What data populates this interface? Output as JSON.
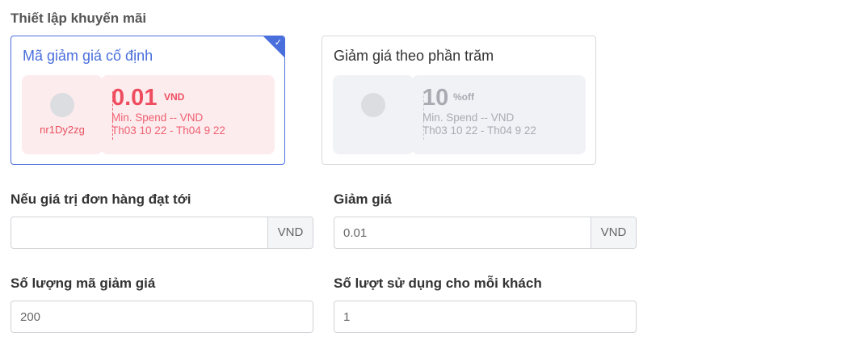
{
  "section_title": "Thiết lập khuyến mãi",
  "promo_types": {
    "fixed": {
      "title": "Mã giảm giá cố định",
      "code": "nr1Dy2zg",
      "amount": "0.01",
      "unit": "VND",
      "min_spend": "Min. Spend -- VND",
      "date_range": "Th03 10 22 - Th04 9 22",
      "selected": true
    },
    "percent": {
      "title": "Giảm giá theo phần trăm",
      "amount": "10",
      "unit": "%off",
      "min_spend": "Min. Spend -- VND",
      "date_range": "Th03 10 22 - Th04 9 22",
      "selected": false
    }
  },
  "fields": {
    "min_order": {
      "label": "Nếu giá trị đơn hàng đạt tới",
      "value": "",
      "addon": "VND"
    },
    "discount": {
      "label": "Giảm giá",
      "value": "0.01",
      "addon": "VND"
    },
    "quantity": {
      "label": "Số lượng mã giảm giá",
      "value": "200"
    },
    "per_customer": {
      "label": "Số lượt sử dụng cho mỗi khách",
      "value": "1"
    }
  },
  "colors": {
    "accent": "#4a6fdc",
    "voucher_red": "#ee4d5f",
    "muted": "#a9abb3"
  }
}
